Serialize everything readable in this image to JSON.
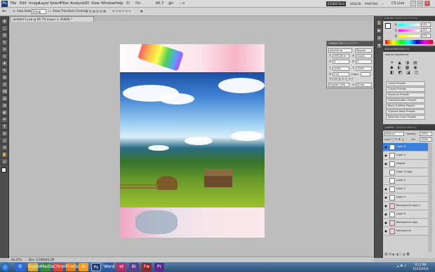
{
  "menu": {
    "app_logo": "Ps",
    "items": [
      "File",
      "Edit",
      "Image",
      "Layer",
      "Select",
      "Filter",
      "Analysis",
      "3D",
      "View",
      "Window",
      "Help"
    ],
    "zoom": "66.7",
    "workspaces": [
      "ESSENTIALS",
      "DESIGN",
      "PAINTING"
    ],
    "cs_live": "CS Live",
    "window_controls": [
      "–",
      "▫",
      "×"
    ]
  },
  "options": {
    "auto_select_label": "Auto-Select:",
    "auto_select_value": "Group",
    "show_transform_label": "Show Transform Controls"
  },
  "document": {
    "tab_title": "Untitled-1.psd @ 66.7% (Layer 3, RGB/8) *",
    "status_zoom": "66.67%",
    "status_doc": "Doc: 6.59M/45.2M"
  },
  "tools": {
    "icons": [
      "move-icon",
      "marquee-icon",
      "lasso-icon",
      "quick-select-icon",
      "crop-icon",
      "eyedropper-icon",
      "healing-icon",
      "brush-icon",
      "clone-stamp-icon",
      "history-brush-icon",
      "eraser-icon",
      "gradient-icon",
      "blur-icon",
      "dodge-icon",
      "pen-icon",
      "type-icon",
      "path-select-icon",
      "shape-icon",
      "3d-rotate-icon",
      "hand-icon",
      "zoom-icon",
      "foreground-color-icon"
    ],
    "glyphs": [
      "✥",
      "⬚",
      "ʘ",
      "✎",
      "⌗",
      "✑",
      "✚",
      "✎",
      "⊕",
      "↺",
      "⌫",
      "▤",
      "◔",
      "◐",
      "✒",
      "T",
      "➤",
      "▭",
      "⟲",
      "✋",
      "⌕",
      "■"
    ]
  },
  "character_panel": {
    "tabs": [
      "CHARACTER",
      "PARAGRAPH"
    ],
    "font_family": "Adventure",
    "font_style": "Regular",
    "font_size": "106.26 pt",
    "leading": "(Auto)",
    "kerning": "0",
    "tracking": "0",
    "vscale": "100%",
    "hscale": "100%",
    "baseline": "0 pt",
    "color_label": "Color:",
    "language": "English: USA",
    "antialias": "Sharp"
  },
  "right_dock": {
    "color_tabs": [
      "COLOR",
      "SWATCHES",
      "STYLES"
    ],
    "color_channels": [
      {
        "label": "R",
        "value": "255"
      },
      {
        "label": "G",
        "value": "255"
      },
      {
        "label": "B",
        "value": "255"
      }
    ],
    "adjust_tabs": [
      "ADJUSTMENTS",
      "MASKS"
    ],
    "adjust_title": "Add an adjustment",
    "presets": [
      "Levels Presets",
      "Curves Presets",
      "Exposure Presets",
      "Hue/Saturation Presets",
      "Black & White Presets",
      "Channel Mixer Presets",
      "Selective Color Presets"
    ],
    "layer_tabs": [
      "LAYERS",
      "CHANNELS",
      "PATHS"
    ],
    "blend_mode": "Normal",
    "opacity_label": "Opacity:",
    "opacity_value": "100%",
    "lock_label": "Lock:",
    "fill_label": "Fill:",
    "fill_value": "100%",
    "layers": [
      "Layer 8",
      "Layer 4",
      "shapes",
      "Layer 3 copy",
      "Layer 5",
      "Layer 2",
      "Layer 3",
      "Background copy 2",
      "Layer 6",
      "Background copy",
      "Background"
    ],
    "selected_layer_index": 0
  },
  "taskbar": {
    "apps": [
      "IE",
      "Explorer",
      "Media",
      "Chrome",
      "Firefox",
      "Ai",
      "Ps",
      "Word",
      "Id",
      "Br",
      "Fw",
      "Pr"
    ],
    "time": "6:12 PM",
    "date": "12/12/2011"
  },
  "colors": {
    "panel_dark": "#4d4d4d",
    "selected_layer": "#3b7fd9",
    "menu_bg": "#d9d9d9"
  }
}
